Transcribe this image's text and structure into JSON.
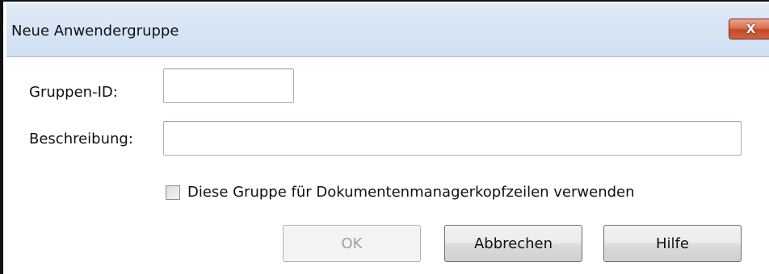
{
  "window": {
    "title": "Neue Anwendergruppe",
    "close_symbol": "X"
  },
  "form": {
    "group_id_label": "Gruppen-ID:",
    "group_id_value": "",
    "description_label": "Beschreibung:",
    "description_value": "",
    "checkbox_label": "Diese Gruppe für Dokumentenmanagerkopfzeilen verwenden",
    "checkbox_checked": false
  },
  "buttons": {
    "ok_label": "OK",
    "ok_enabled": false,
    "cancel_label": "Abbrechen",
    "help_label": "Hilfe"
  },
  "colors": {
    "titlebar": "#dfeaf7",
    "close_button": "#c24a26",
    "disabled_text": "#a0a0a0"
  },
  "icons": {
    "close": "close-icon"
  }
}
